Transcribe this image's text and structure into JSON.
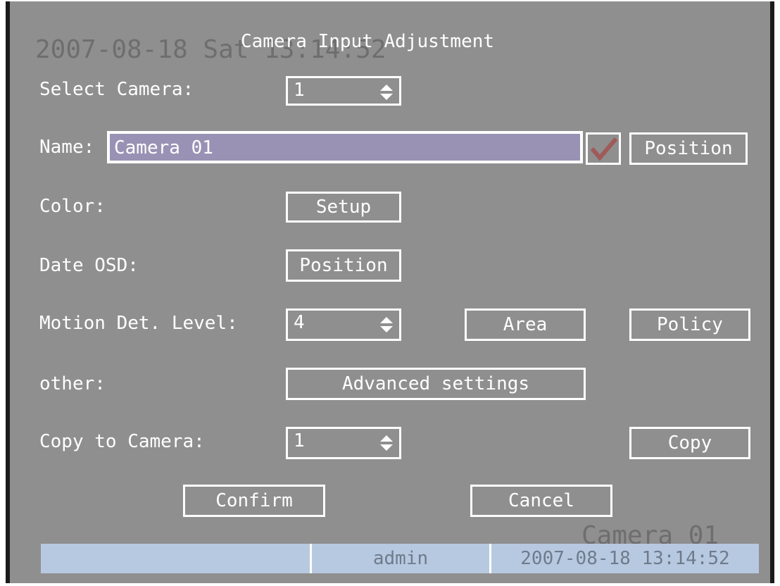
{
  "osd": {
    "date_overlay": "2007-08-18 Sat 13:14:52",
    "camera_overlay": "Camera 01"
  },
  "dialog": {
    "title": "Camera Input Adjustment",
    "select_camera": {
      "label": "Select Camera:",
      "value": "1"
    },
    "name": {
      "label": "Name:",
      "value": "Camera 01",
      "checked": true,
      "position_button": "Position"
    },
    "color": {
      "label": "Color:",
      "setup_button": "Setup"
    },
    "date_osd": {
      "label": "Date OSD:",
      "position_button": "Position"
    },
    "motion": {
      "label": "Motion Det. Level:",
      "value": "4",
      "area_button": "Area",
      "policy_button": "Policy"
    },
    "other": {
      "label": "other:",
      "advanced_button": "Advanced settings"
    },
    "copy_to": {
      "label": "Copy to Camera:",
      "value": "1",
      "copy_button": "Copy"
    },
    "confirm_button": "Confirm",
    "cancel_button": "Cancel"
  },
  "status_bar": {
    "left": "",
    "user": "admin",
    "datetime": "2007-08-18 13:14:52"
  },
  "icons": {
    "spinner": "up-down-arrows-icon",
    "check": "checkmark-icon"
  },
  "colors": {
    "background": "#8f8f8f",
    "field_fill": "#9a92b4",
    "checkmark": "#a05a5a",
    "status_bar": "#b7c9e0"
  }
}
